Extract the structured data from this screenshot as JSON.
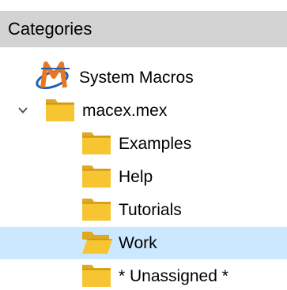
{
  "panel": {
    "header_title": "Categories"
  },
  "tree": {
    "items": [
      {
        "label": "System Macros",
        "icon": "macro-logo-icon",
        "level": 0,
        "selected": false
      },
      {
        "label": "macex.mex",
        "icon": "folder-icon",
        "level": 0,
        "expanded": true,
        "selected": false
      },
      {
        "label": "Examples",
        "icon": "folder-icon",
        "level": 1,
        "selected": false
      },
      {
        "label": "Help",
        "icon": "folder-icon",
        "level": 1,
        "selected": false
      },
      {
        "label": "Tutorials",
        "icon": "folder-icon",
        "level": 1,
        "selected": false
      },
      {
        "label": "Work",
        "icon": "folder-icon",
        "level": 1,
        "selected": true
      },
      {
        "label": "* Unassigned *",
        "icon": "folder-icon",
        "level": 1,
        "selected": false
      }
    ]
  },
  "colors": {
    "header_bg": "#d3d3d3",
    "selection_bg": "#cce8ff",
    "folder_yellow": "#f7c531",
    "folder_dark": "#b8860b",
    "macro_blue": "#1e5fb4",
    "macro_orange": "#e87722"
  }
}
